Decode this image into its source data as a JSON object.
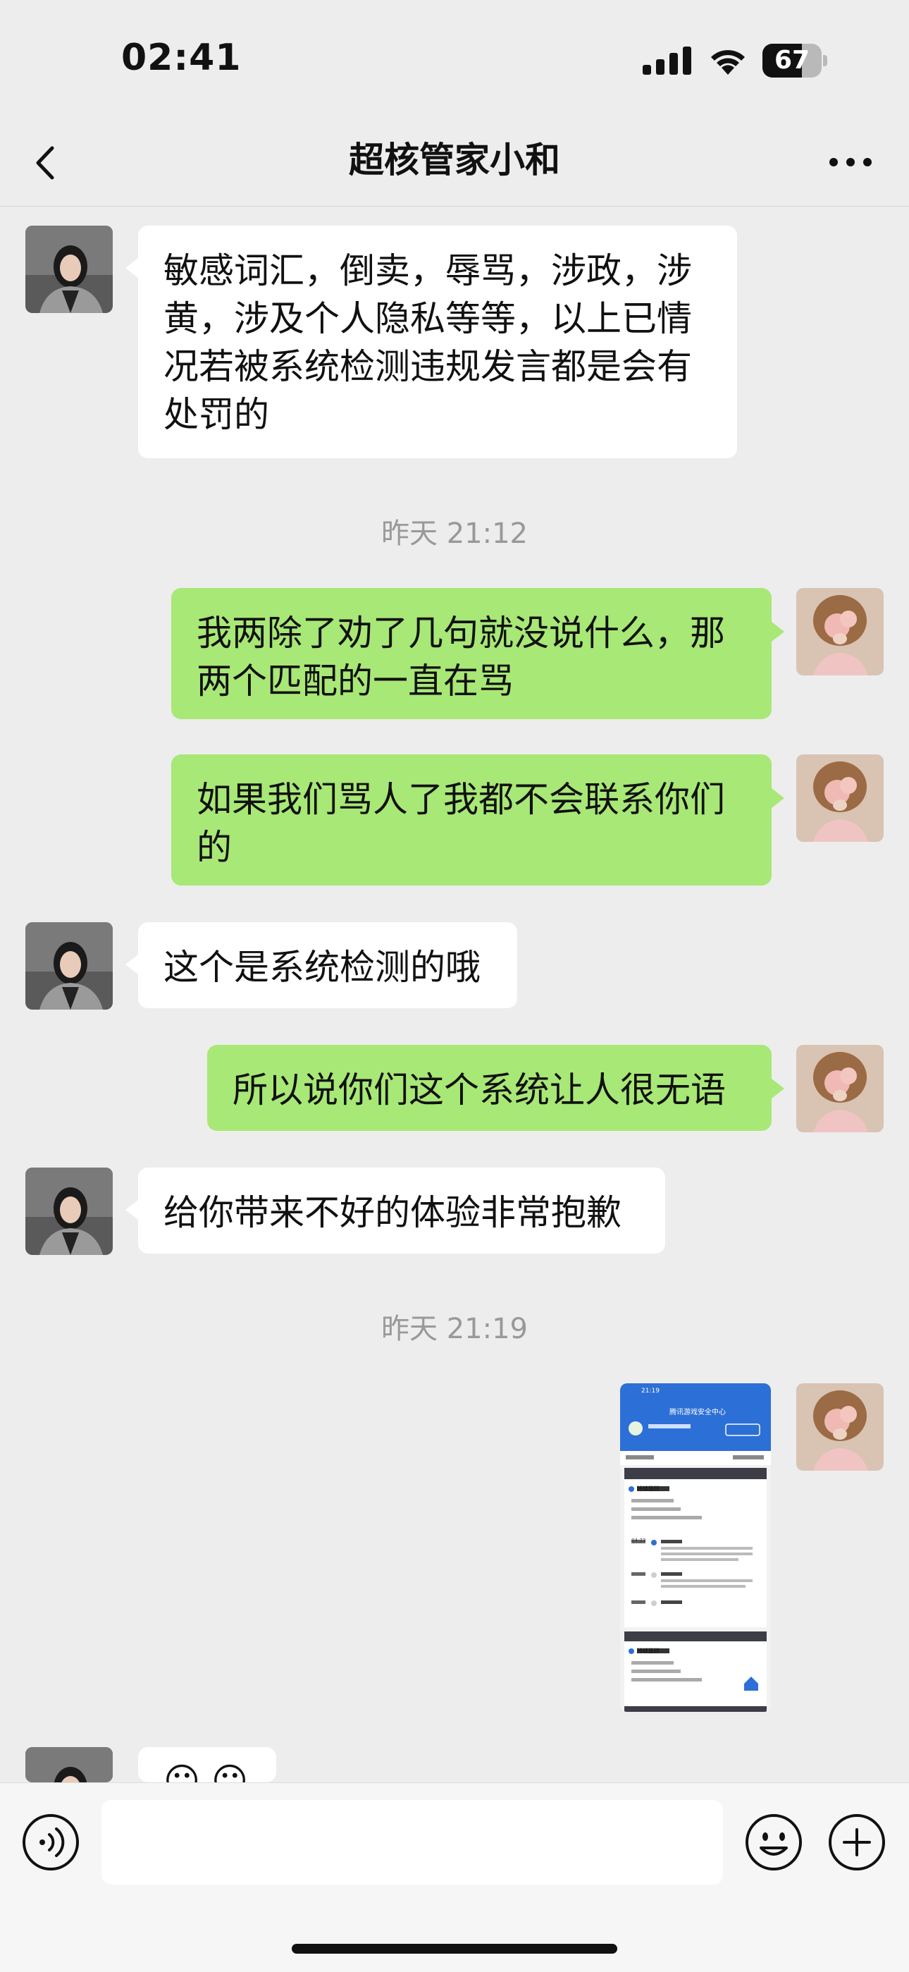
{
  "status_bar": {
    "time": "02:41",
    "battery_percent": "67",
    "battery_level": 0.67
  },
  "header": {
    "title": "超核管家小和"
  },
  "messages": [
    {
      "side": "in",
      "text": "敏感词汇，倒卖，辱骂，涉政，涉黄，涉及个人隐私等等，以上已情况若被系统检测违规发言都是会有处罚的"
    },
    {
      "type": "time",
      "text": "昨天 21:12"
    },
    {
      "side": "out",
      "text": "我两除了劝了几句就没说什么，那两个匹配的一直在骂"
    },
    {
      "side": "out",
      "text": "如果我们骂人了我都不会联系你们的"
    },
    {
      "side": "in",
      "text": "这个是系统检测的哦"
    },
    {
      "side": "out",
      "text": "所以说你们这个系统让人很无语"
    },
    {
      "side": "in",
      "text": "给你带来不好的体验非常抱歉"
    },
    {
      "type": "time",
      "text": "昨天 21:19"
    },
    {
      "side": "out",
      "type": "image",
      "text": ""
    },
    {
      "side": "in",
      "text": "😐 😐"
    }
  ],
  "screenshot_thumbnail": {
    "time": "21:19",
    "title": "腾讯游戏安全中心",
    "item1_title": "持续监控",
    "item2_title": "持续监控",
    "date": "04-23"
  },
  "input": {
    "placeholder": ""
  },
  "colors": {
    "bubble_out": "#a8e876",
    "bubble_in": "#ffffff",
    "background": "#ededed"
  }
}
